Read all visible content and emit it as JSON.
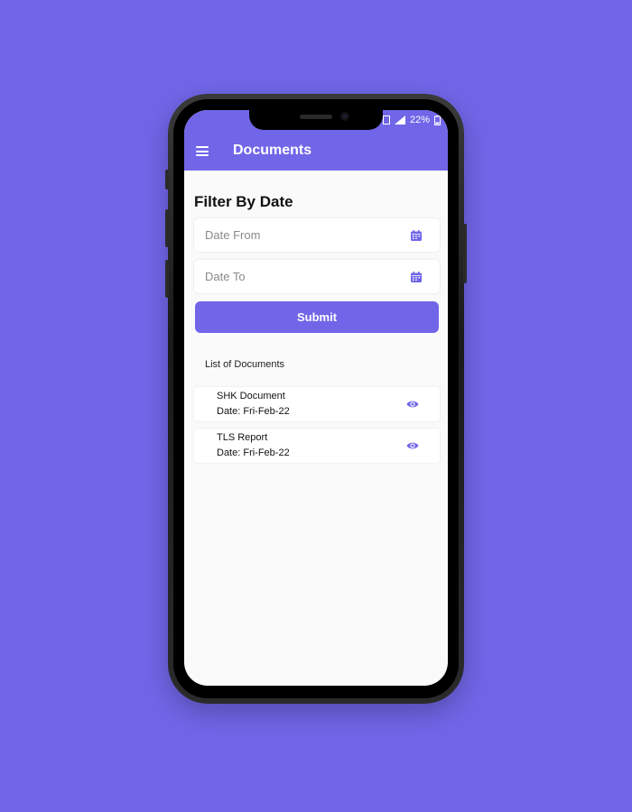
{
  "status_bar": {
    "battery": "22%"
  },
  "app_bar": {
    "title": "Documents",
    "menu_icon": "hamburger-menu-icon"
  },
  "filter": {
    "heading": "Filter By Date",
    "date_from": {
      "placeholder": "Date From",
      "icon": "calendar-icon"
    },
    "date_to": {
      "placeholder": "Date To",
      "icon": "calendar-icon"
    },
    "submit_label": "Submit"
  },
  "documents": {
    "heading": "List of Documents",
    "items": [
      {
        "name": "SHK Document",
        "date": "Date: Fri-Feb-22",
        "action_icon": "eye-icon"
      },
      {
        "name": "TLS Report",
        "date": "Date: Fri-Feb-22",
        "action_icon": "eye-icon"
      }
    ]
  },
  "colors": {
    "accent": "#7166e8",
    "background": "#fafafa"
  }
}
